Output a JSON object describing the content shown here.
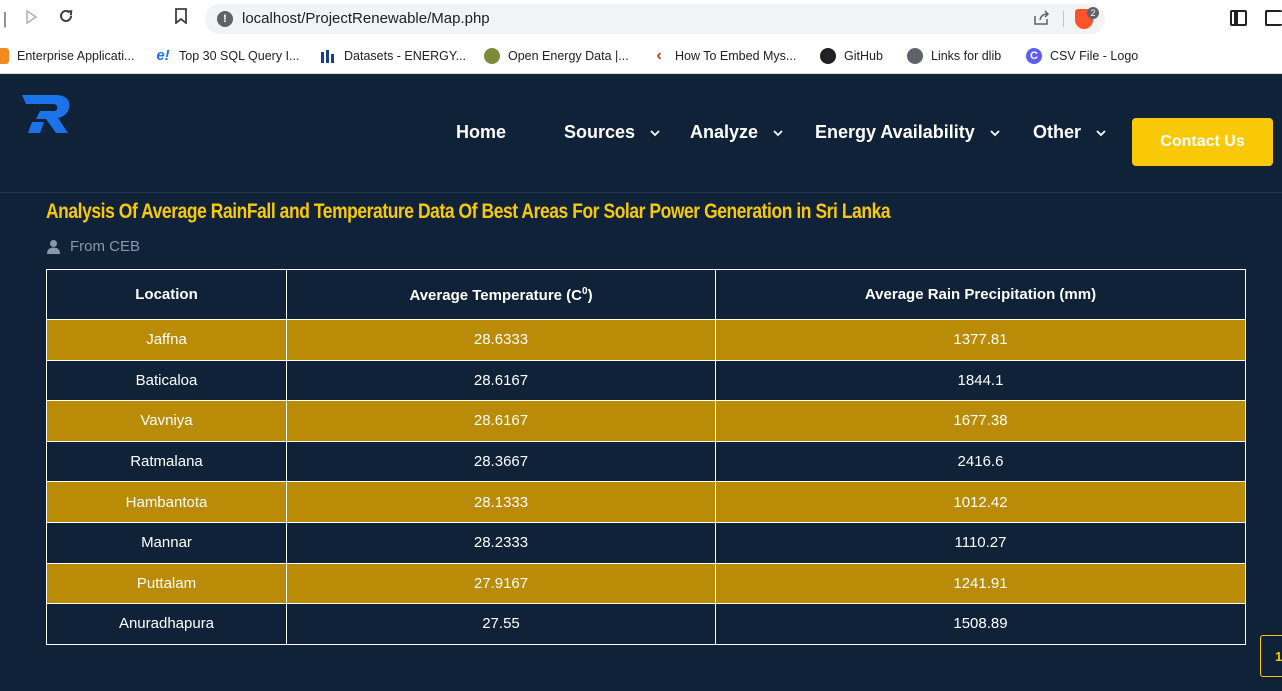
{
  "browser": {
    "url": "localhost/ProjectRenewable/Map.php",
    "brave_badge_count": "2",
    "bookmarks": [
      {
        "label": "Enterprise Applicati...",
        "icon": "enterprise-icon"
      },
      {
        "label": "Top 30 SQL Query I...",
        "icon": "edureka-icon"
      },
      {
        "label": "Datasets - ENERGY...",
        "icon": "datasets-icon"
      },
      {
        "label": "Open Energy Data |...",
        "icon": "open-energy-icon"
      },
      {
        "label": "How To Embed Mys...",
        "icon": "embed-icon"
      },
      {
        "label": "GitHub",
        "icon": "github-icon"
      },
      {
        "label": "Links for dlib",
        "icon": "globe-icon"
      },
      {
        "label": "CSV File - Logo",
        "icon": "canva-icon"
      }
    ]
  },
  "nav": {
    "home": "Home",
    "sources": "Sources",
    "analyze": "Analyze",
    "energy": "Energy Availability",
    "other": "Other",
    "contact": "Contact Us"
  },
  "page": {
    "title": "Analysis Of Average RainFall and Temperature Data Of Best Areas For Solar Power Generation in Sri Lanka",
    "byline": "From CEB"
  },
  "table": {
    "headers": {
      "location": "Location",
      "temperature": "Average Temperature (C",
      "temperature_sup": "0",
      "temperature_close": ")",
      "rain": "Average Rain Precipitation (mm)"
    },
    "rows": [
      {
        "location": "Jaffna",
        "temperature": "28.6333",
        "rain": "1377.81"
      },
      {
        "location": "Baticaloa",
        "temperature": "28.6167",
        "rain": "1844.1"
      },
      {
        "location": "Vavniya",
        "temperature": "28.6167",
        "rain": "1677.38"
      },
      {
        "location": "Ratmalana",
        "temperature": "28.3667",
        "rain": "2416.6"
      },
      {
        "location": "Hambantota",
        "temperature": "28.1333",
        "rain": "1012.42"
      },
      {
        "location": "Mannar",
        "temperature": "28.2333",
        "rain": "1110.27"
      },
      {
        "location": "Puttalam",
        "temperature": "27.9167",
        "rain": "1241.91"
      },
      {
        "location": "Anuradhapura",
        "temperature": "27.55",
        "rain": "1508.89"
      }
    ]
  },
  "scroll_top_label": "1",
  "colors": {
    "background": "#0f2238",
    "accent": "#f9c908",
    "row_highlight": "#b98b06"
  }
}
